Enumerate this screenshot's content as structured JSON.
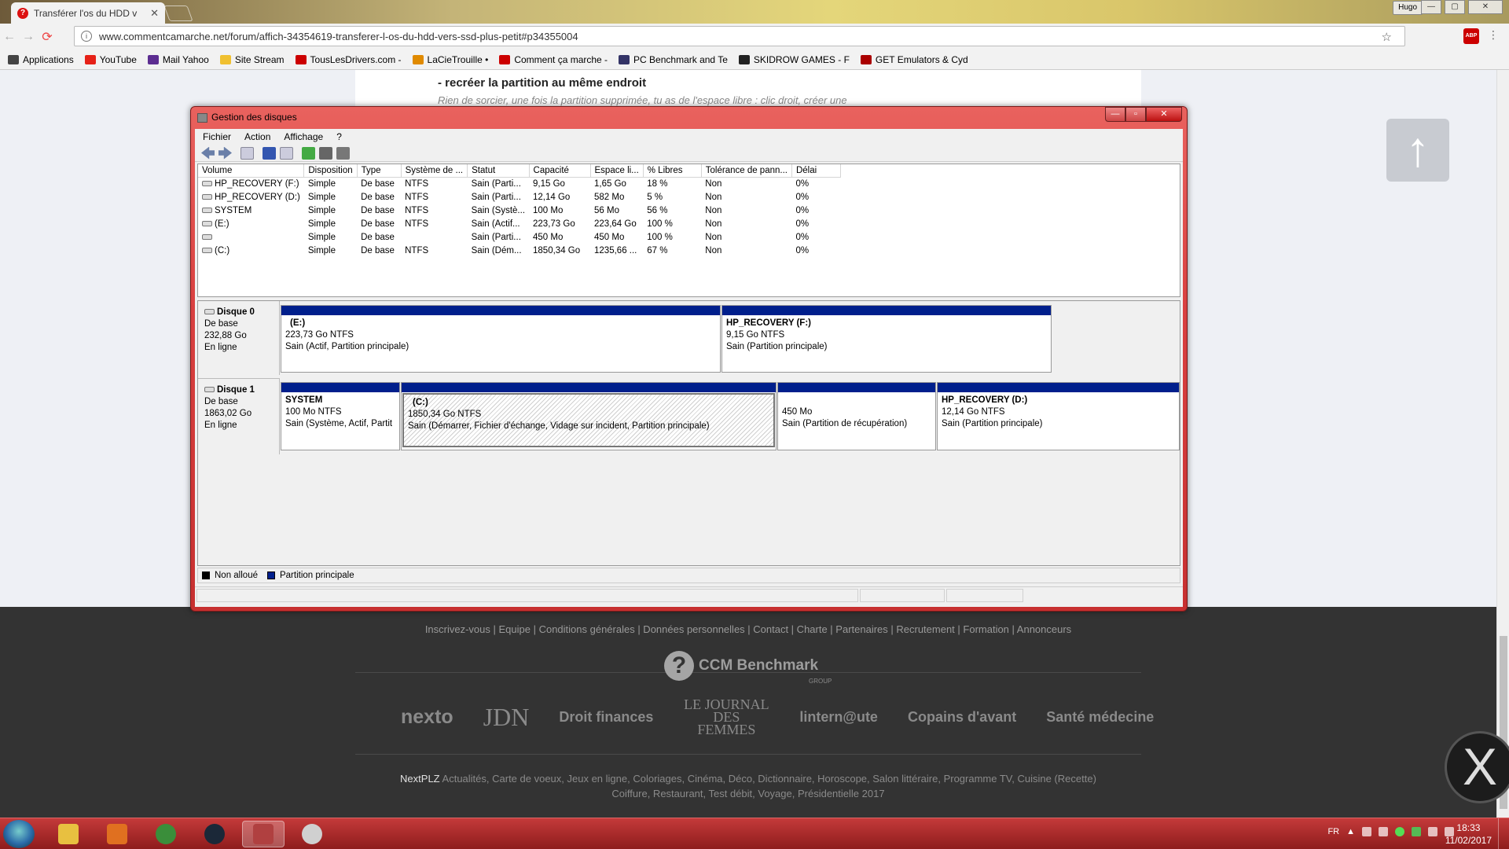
{
  "browser": {
    "tab_title": "Transférer l'os du HDD v",
    "tab_close": "✕",
    "url": "www.commentcamarche.net/forum/affich-34354619-transferer-l-os-du-hdd-vers-ssd-plus-petit#p34355004",
    "user_badge": "Hugo",
    "win_min": "—",
    "win_max": "▢",
    "win_close": "✕",
    "nav_back": "←",
    "nav_forward": "→",
    "nav_reload": "⟳",
    "info_icon": "i",
    "star_icon": "☆",
    "abp": "ABP",
    "menu_icon": "⋮"
  },
  "bookmarks": [
    {
      "label": "Applications",
      "color": "#444"
    },
    {
      "label": "YouTube",
      "color": "#e62117"
    },
    {
      "label": "Mail Yahoo",
      "color": "#5c2d91"
    },
    {
      "label": "Site Stream",
      "color": "#f0c030"
    },
    {
      "label": "TousLesDrivers.com -",
      "color": "#c00"
    },
    {
      "label": "LaCieTrouille •",
      "color": "#e08a00"
    },
    {
      "label": "Comment ça marche -",
      "color": "#c00"
    },
    {
      "label": "PC Benchmark and Te",
      "color": "#336"
    },
    {
      "label": "SKIDROW GAMES - F",
      "color": "#222"
    },
    {
      "label": "GET Emulators & Cyd",
      "color": "#a00"
    }
  ],
  "article": {
    "heading": "- recréer la partition au même endroit",
    "text": "Rien de sorcier, une fois la partition supprimée, tu as de l'espace libre : clic droit, créer une"
  },
  "scroll_up_icon": "↑",
  "disk_manager": {
    "title": "Gestion des disques",
    "btn_min": "—",
    "btn_max": "▫",
    "btn_close": "✕",
    "menu": [
      "Fichier",
      "Action",
      "Affichage",
      "?"
    ],
    "columns": [
      "Volume",
      "Disposition",
      "Type",
      "Système de ...",
      "Statut",
      "Capacité",
      "Espace li...",
      "% Libres",
      "Tolérance de pann...",
      "Délai"
    ],
    "rows": [
      [
        "HP_RECOVERY (F:)",
        "Simple",
        "De base",
        "NTFS",
        "Sain (Parti...",
        "9,15 Go",
        "1,65 Go",
        "18 %",
        "Non",
        "0%"
      ],
      [
        "HP_RECOVERY (D:)",
        "Simple",
        "De base",
        "NTFS",
        "Sain (Parti...",
        "12,14 Go",
        "582 Mo",
        "5 %",
        "Non",
        "0%"
      ],
      [
        "SYSTEM",
        "Simple",
        "De base",
        "NTFS",
        "Sain (Systè...",
        "100 Mo",
        "56 Mo",
        "56 %",
        "Non",
        "0%"
      ],
      [
        "(E:)",
        "Simple",
        "De base",
        "NTFS",
        "Sain (Actif...",
        "223,73 Go",
        "223,64 Go",
        "100 %",
        "Non",
        "0%"
      ],
      [
        "",
        "Simple",
        "De base",
        "",
        "Sain (Parti...",
        "450 Mo",
        "450 Mo",
        "100 %",
        "Non",
        "0%"
      ],
      [
        "(C:)",
        "Simple",
        "De base",
        "NTFS",
        "Sain (Dém...",
        "1850,34 Go",
        "1235,66 ...",
        "67 %",
        "Non",
        "0%"
      ]
    ],
    "disk0": {
      "name": "Disque 0",
      "type": "De base",
      "size": "232,88 Go",
      "state": "En ligne",
      "partitions": [
        {
          "name": "(E:)",
          "size": "223,73 Go NTFS",
          "status": "Sain (Actif, Partition principale)"
        },
        {
          "name": "HP_RECOVERY  (F:)",
          "size": "9,15 Go NTFS",
          "status": "Sain (Partition principale)"
        }
      ]
    },
    "disk1": {
      "name": "Disque 1",
      "type": "De base",
      "size": "1863,02 Go",
      "state": "En ligne",
      "partitions": [
        {
          "name": "SYSTEM",
          "size": "100 Mo NTFS",
          "status": "Sain (Système, Actif, Partit"
        },
        {
          "name": "(C:)",
          "size": "1850,34 Go NTFS",
          "status": "Sain (Démarrer, Fichier d'échange, Vidage sur incident, Partition principale)"
        },
        {
          "name": "",
          "size": "450 Mo",
          "status": "Sain (Partition de récupération)"
        },
        {
          "name": "HP_RECOVERY  (D:)",
          "size": "12,14 Go NTFS",
          "status": "Sain (Partition principale)"
        }
      ]
    },
    "legend": [
      {
        "label": "Non alloué",
        "color": "#000000"
      },
      {
        "label": "Partition principale",
        "color": "#001f8c"
      }
    ]
  },
  "footer": {
    "links": "Inscrivez-vous | Equipe | Conditions générales | Données personnelles | Contact | Charte | Partenaires | Recrutement | Formation | Annonceurs",
    "group_logo_q": "?",
    "group_logo": "CCM Benchmark",
    "group_sub": "GROUP",
    "brands": [
      "nexto",
      "JDN",
      "Droit finances",
      "LE JOURNAL DES FEMMES",
      "lintern@ute",
      "Copains d'avant",
      "Santé médecine"
    ],
    "nextplz_label": "NextPLZ",
    "nextplz_line1": "Actualités, Carte de voeux, Jeux en ligne, Coloriages, Cinéma, Déco, Dictionnaire, Horoscope, Salon littéraire, Programme TV, Cuisine (Recette)",
    "nextplz_line2": "Coiffure, Restaurant, Test débit, Voyage, Présidentielle 2017"
  },
  "x_badge": "X",
  "taskbar": {
    "apps": [
      {
        "name": "explorer",
        "color": "#e8c040"
      },
      {
        "name": "media-player",
        "color": "#e07020"
      },
      {
        "name": "chrome",
        "color": "#3a8e3a"
      },
      {
        "name": "steam",
        "color": "#1b2838"
      },
      {
        "name": "disk-management",
        "color": "#b04040"
      },
      {
        "name": "tool",
        "color": "#d0d0d0"
      }
    ],
    "language": "FR",
    "tray_arrow": "▲",
    "time": "18:33",
    "date": "11/02/2017"
  }
}
